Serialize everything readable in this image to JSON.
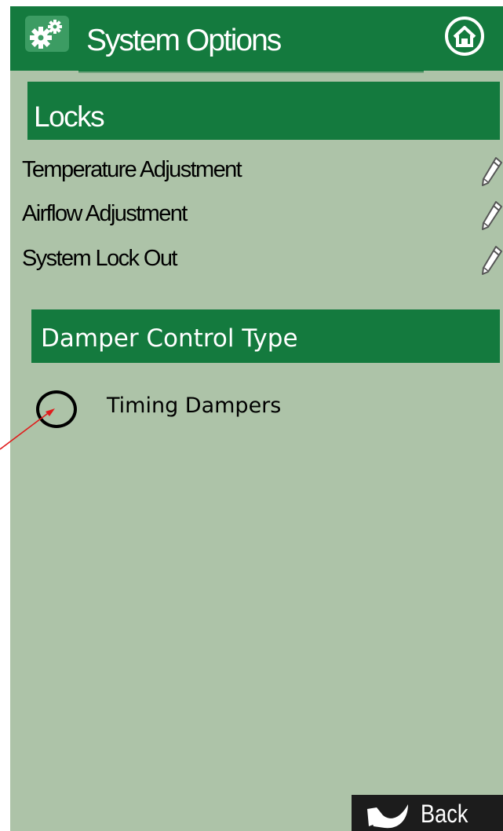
{
  "header": {
    "title": "System Options",
    "gear_icon": "gears-icon",
    "home_icon": "home-icon"
  },
  "locks": {
    "heading": "Locks",
    "items": [
      {
        "label": "Temperature Adjustment",
        "icon": "pencil-icon"
      },
      {
        "label": "Airflow Adjustment",
        "icon": "pencil-icon"
      },
      {
        "label": "System Lock Out",
        "icon": "pencil-icon"
      }
    ]
  },
  "damper": {
    "heading": "Damper Control Type",
    "option_label": "Timing Dampers",
    "selected": false
  },
  "footer": {
    "back_label": "Back"
  },
  "colors": {
    "header_green": "#147a3e",
    "screen_background": "#adc3a8",
    "back_button": "#1c1c1c",
    "annotation": "#e01b1b"
  }
}
